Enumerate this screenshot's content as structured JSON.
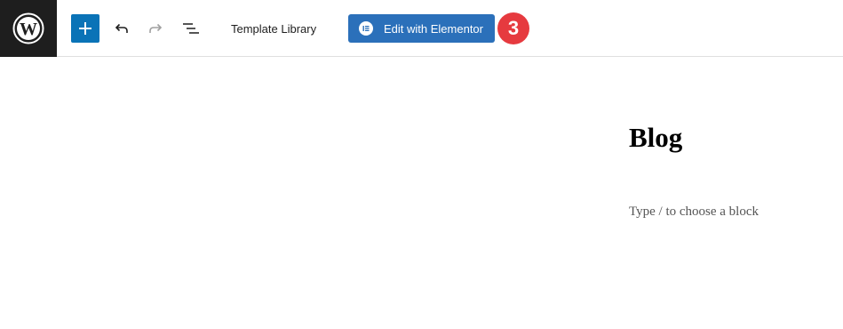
{
  "toolbar": {
    "template_library_label": "Template Library",
    "edit_elementor_label": "Edit with Elementor",
    "step_badge": "3"
  },
  "icons": {
    "logo": "wordpress-logo-icon",
    "add": "plus-icon",
    "undo": "undo-icon",
    "redo": "redo-icon",
    "list_view": "list-view-icon",
    "elementor": "elementor-icon"
  },
  "colors": {
    "logo_bg": "#1e1e1e",
    "add_button": "#0a73b7",
    "elementor_button": "#2b70ba",
    "step_badge": "#e63a3f"
  },
  "editor": {
    "title": "Blog",
    "placeholder": "Type / to choose a block"
  }
}
